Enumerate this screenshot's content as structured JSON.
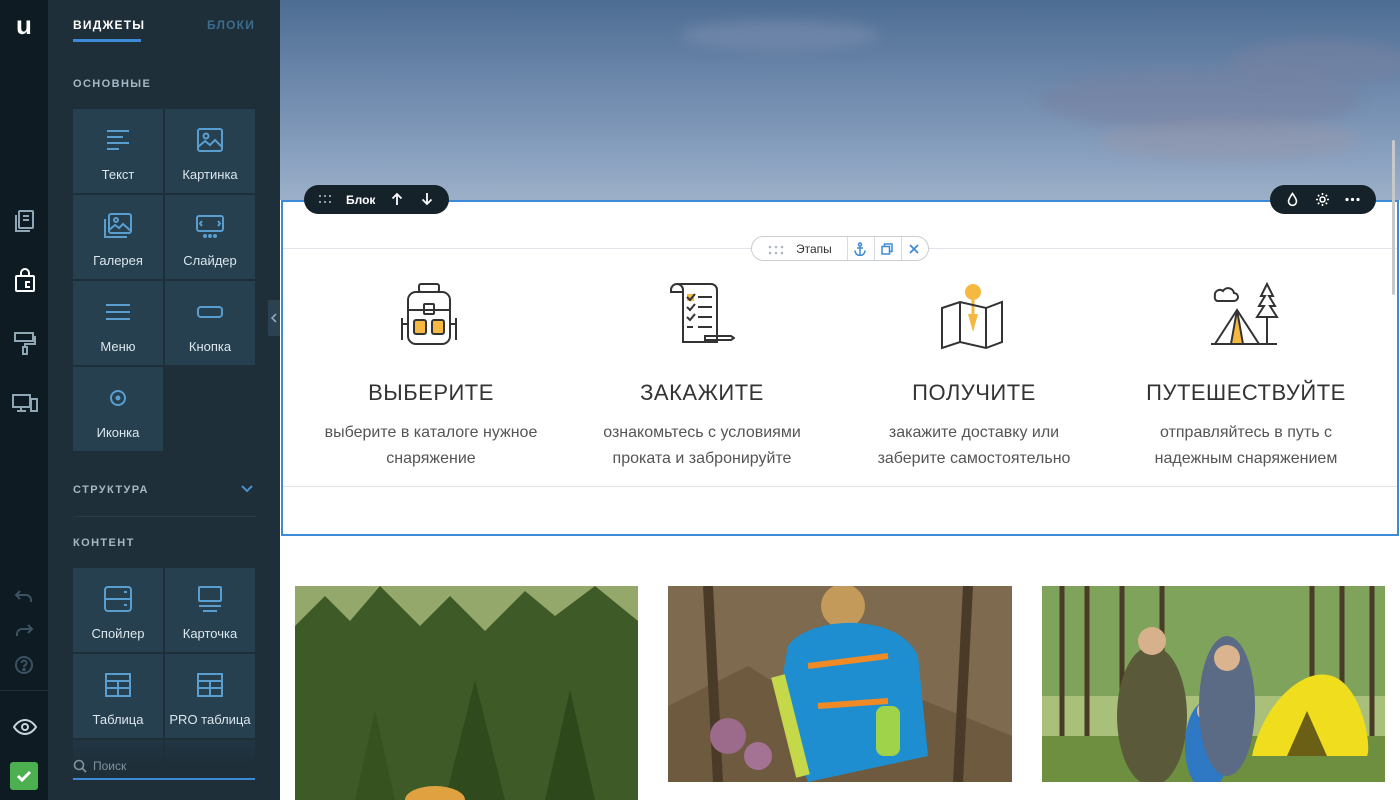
{
  "rail": {
    "logo": "u",
    "accent": "#4caf50"
  },
  "panel": {
    "tabs": {
      "widgets": "ВИДЖЕТЫ",
      "blocks": "БЛОКИ"
    },
    "sections": {
      "basic": "ОСНОВНЫЕ",
      "structure": "СТРУКТУРА",
      "content": "КОНТЕНТ"
    },
    "basic_widgets": [
      {
        "label": "Текст",
        "icon": "text-icon"
      },
      {
        "label": "Картинка",
        "icon": "image-icon"
      },
      {
        "label": "Галерея",
        "icon": "gallery-icon"
      },
      {
        "label": "Слайдер",
        "icon": "slider-icon"
      },
      {
        "label": "Меню",
        "icon": "menu-icon"
      },
      {
        "label": "Кнопка",
        "icon": "button-icon"
      },
      {
        "label": "Иконка",
        "icon": "icon-widget-icon"
      }
    ],
    "content_widgets": [
      {
        "label": "Спойлер",
        "icon": "spoiler-icon"
      },
      {
        "label": "Карточка",
        "icon": "card-icon"
      },
      {
        "label": "Таблица",
        "icon": "table-icon"
      },
      {
        "label": "PRO таблица",
        "icon": "pro-table-icon"
      }
    ],
    "search": {
      "placeholder": "Поиск",
      "value": ""
    }
  },
  "canvas": {
    "block_toolbar": {
      "label": "Блок"
    },
    "widget_toolbar": {
      "label": "Этапы"
    },
    "steps": [
      {
        "title": "ВЫБЕРИТЕ",
        "desc1": "выберите в каталоге нужное",
        "desc2": "снаряжение",
        "icon": "backpack-icon"
      },
      {
        "title": "ЗАКАЖИТЕ",
        "desc1": "ознакомьтесь с условиями",
        "desc2": "проката и забронируйте",
        "icon": "checklist-icon"
      },
      {
        "title": "ПОЛУЧИТЕ",
        "desc1": "закажите доставку или",
        "desc2": "заберите самостоятельно",
        "icon": "map-pin-icon"
      },
      {
        "title": "ПУТЕШЕСТВУЙТЕ",
        "desc1": "отправляйтесь в путь с",
        "desc2": "надежным снаряжением",
        "icon": "tent-icon"
      }
    ],
    "colors": {
      "selection": "#3d8bd6",
      "step_accent": "#f5b942"
    }
  }
}
